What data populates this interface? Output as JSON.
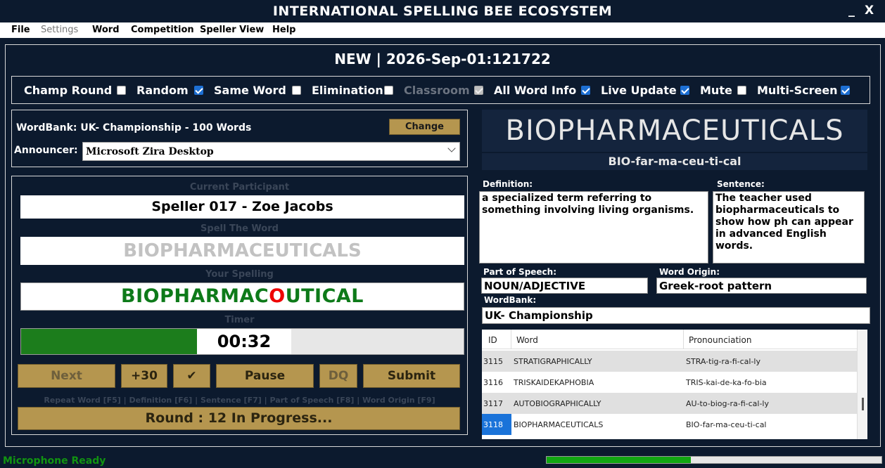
{
  "app": {
    "title": "INTERNATIONAL SPELLING BEE ECOSYSTEM",
    "min_glyph": "_",
    "close_glyph": "X"
  },
  "menu": [
    "File",
    "Settings",
    "Word",
    "Competition",
    "Speller View",
    "Help"
  ],
  "heading": "NEW  | 2026-Sep-01:121722",
  "options": [
    {
      "label": "Champ Round",
      "checked": false
    },
    {
      "label": "Random",
      "checked": true
    },
    {
      "label": "Same Word",
      "checked": false
    },
    {
      "label": "Elimination",
      "checked": false
    },
    {
      "label": "Classroom",
      "checked": true,
      "disabled": true
    },
    {
      "label": "All Word Info",
      "checked": true
    },
    {
      "label": "Live Update",
      "checked": true
    },
    {
      "label": "Mute",
      "checked": false
    },
    {
      "label": "Multi-Screen",
      "checked": true
    }
  ],
  "wordbank_panel": {
    "wordbank_label": "WordBank: UK-   Championship - 100 Words",
    "change_button": "Change",
    "announcer_label": "Announcer:",
    "announcer_value": "Microsoft Zira Desktop"
  },
  "game": {
    "participant_caption": "Current Participant",
    "participant": "Speller 017 - Zoe Jacobs",
    "spell_caption": "Spell The Word",
    "target_word": "BIOPHARMACEUTICALS",
    "your_spelling_caption": "Your Spelling",
    "spelling_before": "BIOPHARMAC",
    "spelling_wrong": "O",
    "spelling_after": "UTICAL",
    "timer_caption": "Timer",
    "timer_value": "00:32",
    "timer_fraction": 0.4,
    "buttons": {
      "next": "Next",
      "plus30": "+30",
      "check": "✔",
      "pause": "Pause",
      "dq": "DQ",
      "submit": "Submit"
    },
    "hotkeys": "Repeat Word [F5] | Definition [F6] | Sentence [F7] | Part of Speech [F8] | Word Origin [F9]",
    "round": "Round :  12 In Progress..."
  },
  "word_info": {
    "word": "BIOPHARMACEUTICALS",
    "pronunciation": "BIO-far-ma-ceu-ti-cal",
    "definition_label": "Definition:",
    "definition": "a specialized term referring to something involving living organisms.",
    "sentence_label": "Sentence:",
    "sentence": "The teacher used biopharmaceuticals to show how ph can appear in advanced English words.",
    "pos_label": "Part of Speech:",
    "pos": "NOUN/ADJECTIVE",
    "origin_label": "Word Origin:",
    "origin": "Greek-root pattern",
    "wordbank_label": "WordBank:",
    "wordbank": "UK-   Championship"
  },
  "grid": {
    "headers": [
      "ID",
      "Word",
      "Pronounciation"
    ],
    "rows": [
      {
        "id": "3115",
        "word": "STRATIGRAPHICALLY",
        "pron": "STRA-tig-ra-fi-cal-ly"
      },
      {
        "id": "3116",
        "word": "TRISKAIDEKAPHOBIA",
        "pron": "TRIS-kai-de-ka-fo-bia"
      },
      {
        "id": "3117",
        "word": "AUTOBIOGRAPHICALLY",
        "pron": "AU-to-biog-ra-fi-cal-ly"
      },
      {
        "id": "3118",
        "word": "BIOPHARMACEUTICALS",
        "pron": "BIO-far-ma-ceu-ti-cal"
      }
    ]
  },
  "status": {
    "mic": "Microphone Ready",
    "progress_fraction": 0.43
  },
  "colors": {
    "background": "#0c1a2e",
    "gold": "#b5964f",
    "green": "#1c7d1c",
    "wrong": "#ee0000",
    "selected": "#1a73d9"
  }
}
